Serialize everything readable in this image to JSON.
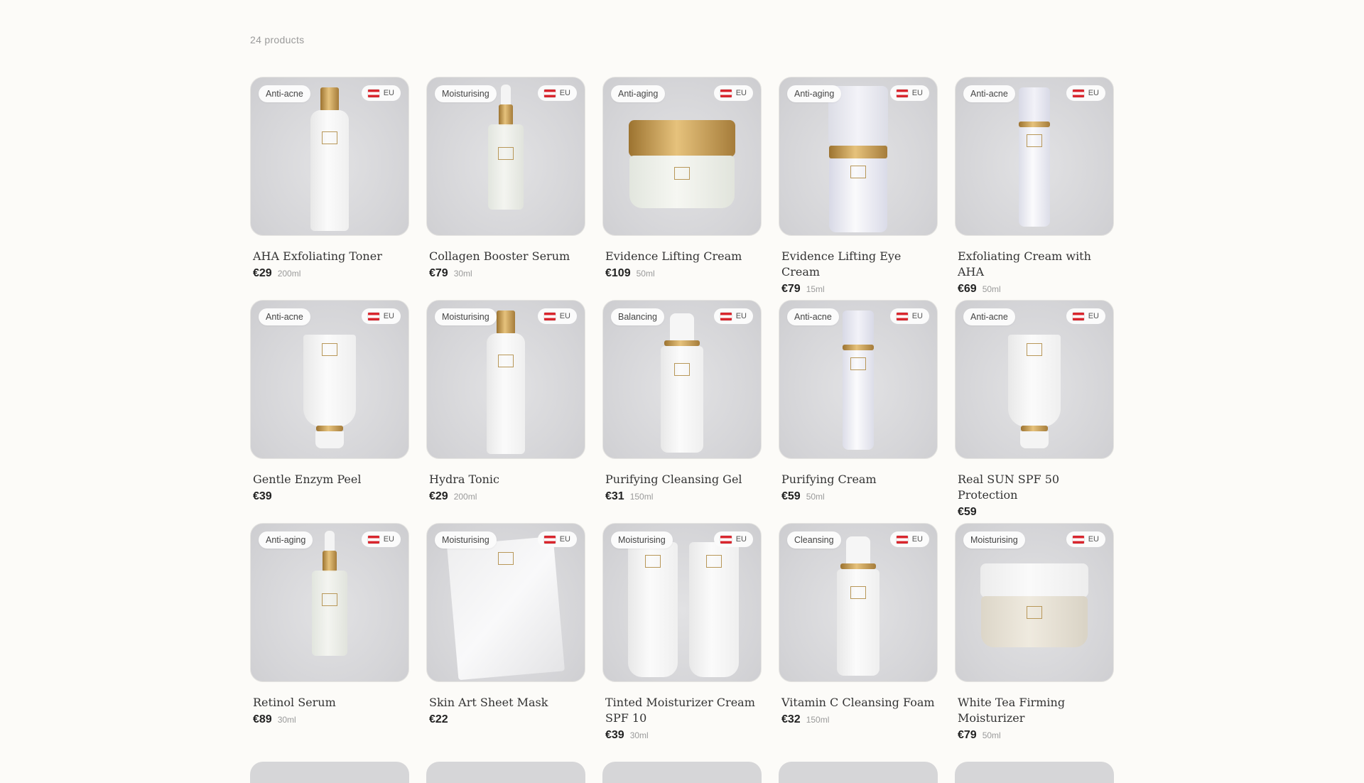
{
  "listing": {
    "count_label": "24 products"
  },
  "products": [
    {
      "category": "Anti-acne",
      "region": "EU",
      "name": "AHA Exfoliating Toner",
      "price": "€29",
      "size": "200ml",
      "art": "toner"
    },
    {
      "category": "Moisturising",
      "region": "EU",
      "name": "Collagen Booster Serum",
      "price": "€79",
      "size": "30ml",
      "art": "serum"
    },
    {
      "category": "Anti-aging",
      "region": "EU",
      "name": "Evidence Lifting Cream",
      "price": "€109",
      "size": "50ml",
      "art": "jar"
    },
    {
      "category": "Anti-aging",
      "region": "EU",
      "name": "Evidence Lifting Eye Cream",
      "price": "€79",
      "size": "15ml",
      "art": "pump"
    },
    {
      "category": "Anti-acne",
      "region": "EU",
      "name": "Exfoliating Cream with AHA",
      "price": "€69",
      "size": "50ml",
      "art": "slim"
    },
    {
      "category": "Anti-acne",
      "region": "EU",
      "name": "Gentle Enzym Peel",
      "price": "€39",
      "size": "",
      "art": "tube"
    },
    {
      "category": "Moisturising",
      "region": "EU",
      "name": "Hydra Tonic",
      "price": "€29",
      "size": "200ml",
      "art": "toner"
    },
    {
      "category": "Balancing",
      "region": "EU",
      "name": "Purifying Cleansing Gel",
      "price": "€31",
      "size": "150ml",
      "art": "bottle"
    },
    {
      "category": "Anti-acne",
      "region": "EU",
      "name": "Purifying Cream",
      "price": "€59",
      "size": "50ml",
      "art": "slim"
    },
    {
      "category": "Anti-acne",
      "region": "EU",
      "name": "Real SUN SPF 50 Protection",
      "price": "€59",
      "size": "",
      "art": "tube"
    },
    {
      "category": "Anti-aging",
      "region": "EU",
      "name": "Retinol Serum",
      "price": "€89",
      "size": "30ml",
      "art": "serum"
    },
    {
      "category": "Moisturising",
      "region": "EU",
      "name": "Skin Art Sheet Mask",
      "price": "€22",
      "size": "",
      "art": "mask"
    },
    {
      "category": "Moisturising",
      "region": "EU",
      "name": "Tinted Moisturizer Cream SPF 10",
      "price": "€39",
      "size": "30ml",
      "art": "twin"
    },
    {
      "category": "Cleansing",
      "region": "EU",
      "name": "Vitamin C Cleansing Foam",
      "price": "€32",
      "size": "150ml",
      "art": "bottle"
    },
    {
      "category": "Moisturising",
      "region": "EU",
      "name": "White Tea Firming Moisturizer",
      "price": "€79",
      "size": "50ml",
      "art": "whitejar"
    }
  ]
}
